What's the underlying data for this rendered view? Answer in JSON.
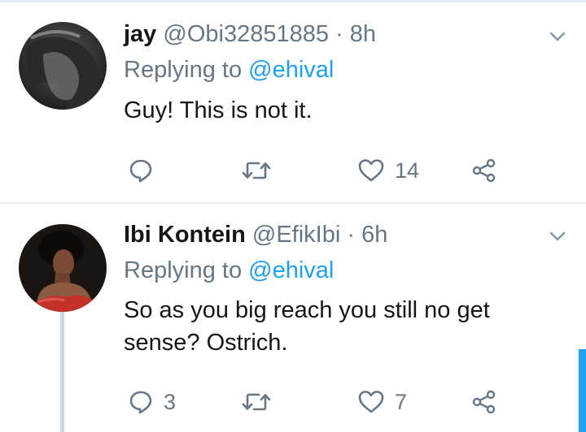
{
  "tweets": [
    {
      "name": "jay",
      "handle": "@Obi32851885",
      "separator": "·",
      "time": "8h",
      "replying_prefix": "Replying to",
      "replying_to": "@ehival",
      "text": "Guy! This is not it.",
      "actions": {
        "reply_count": "",
        "retweet_count": "",
        "like_count": "14"
      }
    },
    {
      "name": "Ibi Kontein",
      "handle": "@EfikIbi",
      "separator": "·",
      "time": "6h",
      "replying_prefix": "Replying to",
      "replying_to": "@ehival",
      "text": "So as you big reach you still no get sense? Ostrich.",
      "actions": {
        "reply_count": "3",
        "retweet_count": "",
        "like_count": "7"
      }
    }
  ],
  "icons": {
    "reply": "reply-icon",
    "retweet": "retweet-icon",
    "like": "heart-icon",
    "share": "share-icon",
    "menu": "chevron-down-icon"
  },
  "colors": {
    "text": "#14171a",
    "secondary": "#657786",
    "link": "#1da1f2",
    "divider": "#e6ecf0",
    "thread_line": "#ccd6dd"
  }
}
